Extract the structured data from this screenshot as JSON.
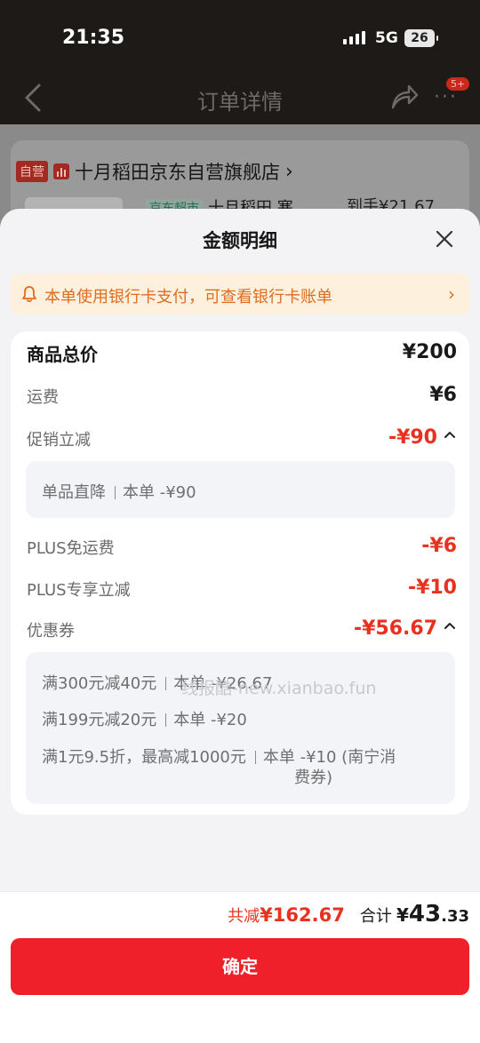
{
  "status_bar": {
    "time": "21:35",
    "network": "5G",
    "battery": "26"
  },
  "nav": {
    "title": "订单详情",
    "more_badge": "5+"
  },
  "store": {
    "self_tag": "自营",
    "name": "十月稻田京东自营旗舰店",
    "item_tag": "京东超市",
    "item_name": "十月稻田 寒",
    "item_price": "到手¥21.67"
  },
  "sheet": {
    "title": "金额明细",
    "notice": "本单使用银行卡支付，可查看银行卡账单",
    "rows": {
      "total": {
        "label": "商品总价",
        "value": "¥200"
      },
      "shipping": {
        "label": "运费",
        "value": "¥6"
      },
      "promo": {
        "label": "促销立减",
        "value": "-¥90"
      },
      "plus_shipping": {
        "label": "PLUS免运费",
        "value": "-¥6"
      },
      "plus_discount": {
        "label": "PLUS专享立减",
        "value": "-¥10"
      },
      "coupon": {
        "label": "优惠券",
        "value": "-¥56.67"
      }
    },
    "promo_detail": [
      {
        "name": "单品直降",
        "amount": "本单 -¥90"
      }
    ],
    "coupon_detail": [
      {
        "name": "满300元减40元",
        "amount": "本单 -¥26.67"
      },
      {
        "name": "满199元减20元",
        "amount": "本单 -¥20"
      },
      {
        "name": "满1元9.5折，最高减1000元",
        "amount": "本单 -¥10 (南宁消",
        "amount_cont": "费券)"
      }
    ],
    "watermark": "线报酷-new.xianbao.fun"
  },
  "footer": {
    "save_label": "共减",
    "save_value": "¥162.67",
    "total_label": "合计",
    "total_yen": "¥",
    "total_int": "43",
    "total_dec": ".33",
    "confirm": "确定"
  },
  "colors": {
    "accent_red": "#e8311e",
    "button_red": "#f0202a",
    "notice_orange": "#e06c1f",
    "notice_bg": "#fdf1dd"
  }
}
